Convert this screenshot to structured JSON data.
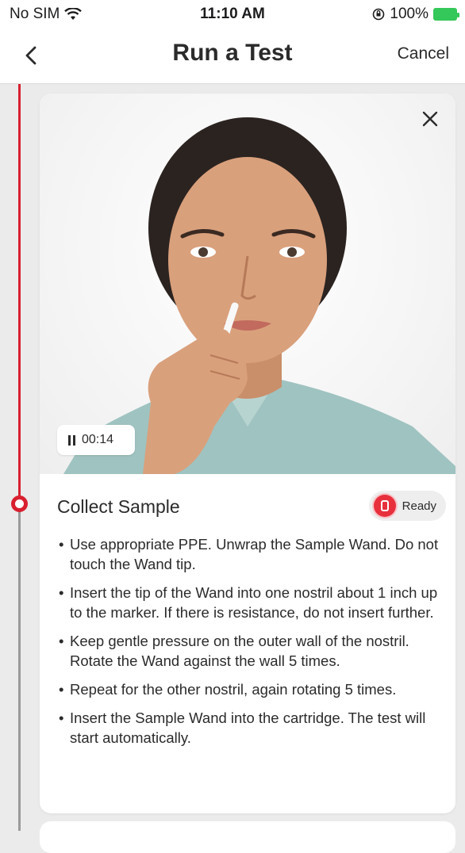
{
  "status_bar": {
    "carrier": "No SIM",
    "time": "11:10 AM",
    "battery": "100%"
  },
  "nav": {
    "title": "Run a Test",
    "cancel_label": "Cancel"
  },
  "video": {
    "timer": "00:14"
  },
  "step": {
    "title": "Collect Sample",
    "badge_label": "Ready",
    "instructions": [
      "Use appropriate PPE. Unwrap the Sample Wand. Do not touch the Wand tip.",
      "Insert the tip of the Wand into one nostril about 1 inch up to the marker. If there is resistance, do not insert further.",
      "Keep gentle pressure on the outer wall of the nostril. Rotate the Wand against the wall 5 times.",
      "Repeat for the other nostril, again rotating 5 times.",
      "Insert the Sample Wand into the cartridge. The test will start automatically."
    ]
  },
  "colors": {
    "accent_red": "#d8202f",
    "timeline_grey": "#9a9a9a",
    "shirt": "#9fc3c0",
    "skin": "#d9a07c",
    "hair": "#2b2320"
  },
  "icons": [
    "wifi-icon",
    "orientation-lock-icon",
    "battery-icon",
    "back-chevron-icon",
    "close-icon",
    "pause-icon",
    "cartridge-icon"
  ]
}
